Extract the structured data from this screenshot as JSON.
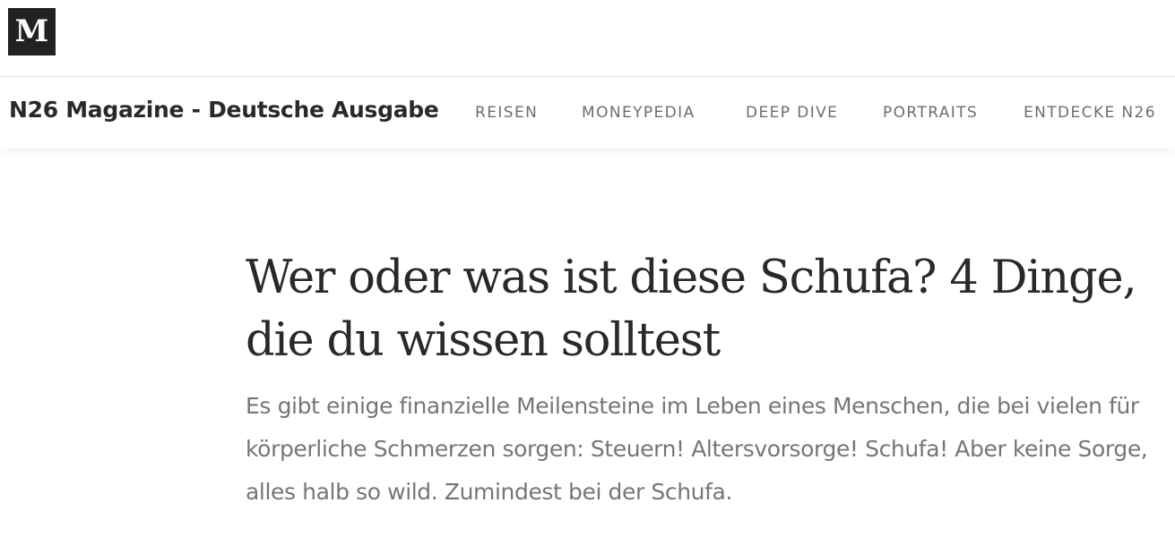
{
  "logo": {
    "letter": "M"
  },
  "publication": {
    "title": "N26 Magazine - Deutsche Ausgabe",
    "nav": [
      {
        "label": "REISEN"
      },
      {
        "label": "MONEYPEDIA"
      },
      {
        "label": "DEEP DIVE"
      },
      {
        "label": "PORTRAITS"
      },
      {
        "label": "ENTDECKE N26"
      }
    ]
  },
  "article": {
    "headline": "Wer oder was ist diese Schufa? 4 Dinge, die du wissen solltest",
    "subtitle": "Es gibt einige finanzielle Meilensteine im Leben eines Menschen, die bei vielen für körperliche Schmerzen sorgen: Steuern! Altersvorsorge! Schufa! Aber keine Sorge, alles halb so wild. Zumindest bei der Schufa."
  },
  "colors": {
    "logo_background": "#222222",
    "divider": "#e6e6e6"
  }
}
